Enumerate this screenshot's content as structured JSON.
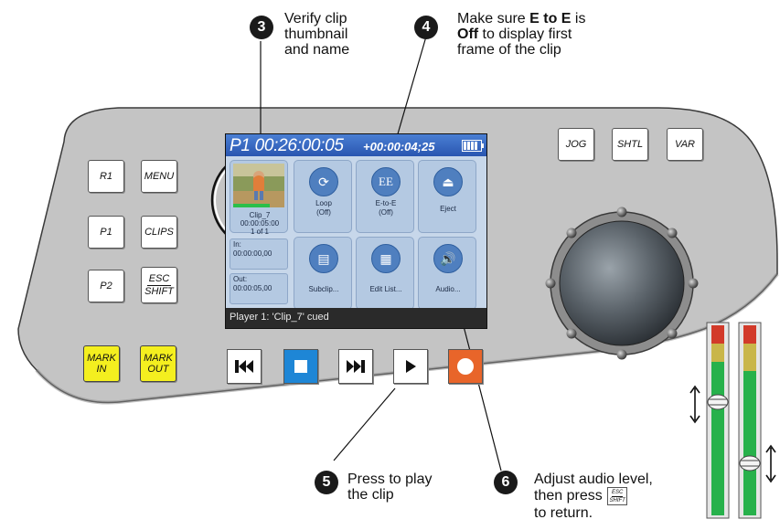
{
  "callouts": {
    "c3": {
      "num": "3",
      "line1": "Verify clip",
      "line2": "thumbnail",
      "line3": "and name"
    },
    "c4": {
      "num": "4",
      "prefix1": "Make sure ",
      "bold1": "E to E",
      "suffix1": " is",
      "bold2": "Off",
      "suffix2": " to display first",
      "line3": "frame of the clip"
    },
    "c5": {
      "num": "5",
      "line1": "Press to play",
      "line2": "the clip"
    },
    "c6": {
      "num": "6",
      "line1": "Adjust audio level,",
      "line2_pre": "then press",
      "line3": "to return."
    }
  },
  "left_keys": {
    "r1": "R1",
    "menu": "MENU",
    "p1": "P1",
    "clips": "CLIPS",
    "p2": "P2",
    "esc": "ESC",
    "shift": "SHIFT",
    "mark_in_1": "MARK",
    "mark_in_2": "IN",
    "mark_out_1": "MARK",
    "mark_out_2": "OUT"
  },
  "right_keys": {
    "jog": "JOG",
    "shtl": "SHTL",
    "var": "VAR"
  },
  "screen": {
    "timecode_main": "P1 00:26:00:05",
    "timecode_secondary": "+00:00:04;25",
    "clip": {
      "name": "Clip_7",
      "duration": "00:00:05:00",
      "index": "1 of 1"
    },
    "in_label": "In:",
    "in_value": "00:00:00,00",
    "out_label": "Out:",
    "out_value": "00:00:05,00",
    "tiles": [
      {
        "icon": "loop-icon",
        "line1": "Loop",
        "line2": "(Off)"
      },
      {
        "icon": "ee-icon",
        "glyph": "EE",
        "line1": "E-to-E",
        "line2": "(Off)"
      },
      {
        "icon": "eject-icon",
        "line1": "Eject",
        "line2": ""
      },
      {
        "icon": "subclip-icon",
        "line1": "Subclip...",
        "line2": ""
      },
      {
        "icon": "edit-list-icon",
        "line1": "Edit List...",
        "line2": ""
      },
      {
        "icon": "audio-icon",
        "line1": "Audio...",
        "line2": ""
      }
    ],
    "status": "Player 1: 'Clip_7' cued"
  },
  "transport": [
    {
      "name": "rewind-to-start-button",
      "icon": "skip-back-icon"
    },
    {
      "name": "stop-button",
      "icon": "stop-icon",
      "color": "#1e86d6"
    },
    {
      "name": "skip-forward-button",
      "icon": "skip-forward-icon"
    },
    {
      "name": "play-button",
      "icon": "play-icon"
    },
    {
      "name": "record-button",
      "icon": "record-icon",
      "color": "#e8652a"
    }
  ],
  "colors": {
    "panel": "#c4c4c4",
    "mark_keys": "#f4ef1f",
    "screen_header": "#3a6cc4",
    "meter_green": "#27b14b",
    "meter_red": "#d23a2a"
  }
}
